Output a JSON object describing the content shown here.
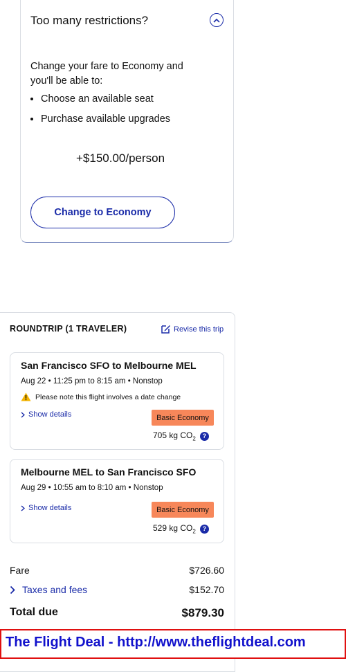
{
  "upsell": {
    "title": "Too many restrictions?",
    "description": "Change your fare to Economy and you'll be able to:",
    "bullets": [
      "Choose an available seat",
      "Purchase available upgrades"
    ],
    "price": "+$150.00/person",
    "button_label": "Change to Economy",
    "collapse_icon": "chevron-up-icon"
  },
  "trip": {
    "heading": "ROUNDTRIP (1 TRAVELER)",
    "revise_label": "Revise this trip",
    "segments": [
      {
        "route": "San Francisco SFO to Melbourne MEL",
        "times": "Aug 22 • 11:25 pm to 8:15 am • Nonstop",
        "warning": "Please note this flight involves a date change",
        "details_label": "Show details",
        "fare_class": "Basic Economy",
        "co2_value": "705 kg CO",
        "co2_sub": "2"
      },
      {
        "route": "Melbourne MEL to San Francisco SFO",
        "times": "Aug 29 • 10:55 am to 8:10 am • Nonstop",
        "details_label": "Show details",
        "fare_class": "Basic Economy",
        "co2_value": "529 kg CO",
        "co2_sub": "2"
      }
    ]
  },
  "summary": {
    "fare_label": "Fare",
    "fare_value": "$726.60",
    "taxes_label": "Taxes and fees",
    "taxes_value": "$152.70",
    "total_label": "Total due",
    "total_value": "$879.30"
  },
  "banner": {
    "text": "The Flight Deal - http://www.theflightdeal.com"
  },
  "colors": {
    "accent": "#1a2ba8",
    "fare_badge": "#f7875a",
    "warning": "#f5b400",
    "banner_border": "#e01010",
    "banner_text": "#1111cc"
  }
}
